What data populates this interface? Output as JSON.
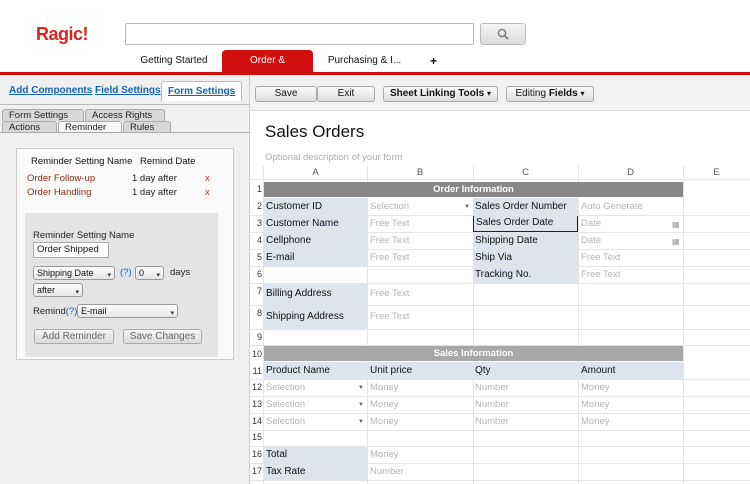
{
  "app": {
    "logo": "Ragic!"
  },
  "search": {
    "placeholder": ""
  },
  "top_tabs": [
    "Getting Started",
    "Order & Billing",
    "Purchasing & I...",
    "+"
  ],
  "left_tabs": [
    "Add Components",
    "Field Settings",
    "Form Settings"
  ],
  "sub_tabs": [
    "Form Settings",
    "Access Rights",
    "Actions",
    "Reminder",
    "Rules"
  ],
  "reminder": {
    "col_name": "Reminder Setting Name",
    "col_date": "Remind Date",
    "rows": [
      {
        "name": "Order Follow-up",
        "date": "1 day after",
        "x": "x"
      },
      {
        "name": "Order Handling",
        "date": "1 day after",
        "x": "x"
      }
    ],
    "form": {
      "name_label": "Reminder Setting Name",
      "name_value": "Order Shipped",
      "date_field": "Shipping Date",
      "help": "(?)",
      "days_value": "0",
      "days_label": "days",
      "when": "after",
      "remind_label": "Remind",
      "remind_help": "(?)",
      "remind_value": "E-mail",
      "add_button": "Add Reminder",
      "save_button": "Save Changes"
    }
  },
  "toolbar": {
    "save": "Save",
    "exit": "Exit",
    "sheet_linking": "Sheet Linking Tools",
    "editing": "Editing",
    "fields": "Fields"
  },
  "form": {
    "title": "Sales Orders",
    "description": "Optional description of your form",
    "columns": [
      "A",
      "B",
      "C",
      "D",
      "E"
    ],
    "rows": [
      "1",
      "2",
      "3",
      "4",
      "5",
      "6",
      "7",
      "8",
      "9",
      "10",
      "11",
      "12",
      "13",
      "14",
      "15",
      "16",
      "17"
    ],
    "section1": "Order Information",
    "section2": "Sales Information",
    "labels": {
      "customer_id": "Customer ID",
      "customer_name": "Customer Name",
      "cellphone": "Cellphone",
      "email": "E-mail",
      "billing": "Billing Address",
      "shipping": "Shipping Address",
      "so_number": "Sales Order Number",
      "so_date": "Sales Order Date",
      "ship_date": "Shipping Date",
      "ship_via": "Ship Via",
      "tracking": "Tracking No.",
      "product": "Product Name",
      "unit_price": "Unit price",
      "qty": "Qty",
      "amount": "Amount",
      "total": "Total",
      "tax_rate": "Tax Rate"
    },
    "placeholders": {
      "selection": "Selection",
      "free_text": "Free Text",
      "auto_generate": "Auto Generate",
      "date": "Date",
      "money": "Money",
      "number": "Number"
    }
  }
}
